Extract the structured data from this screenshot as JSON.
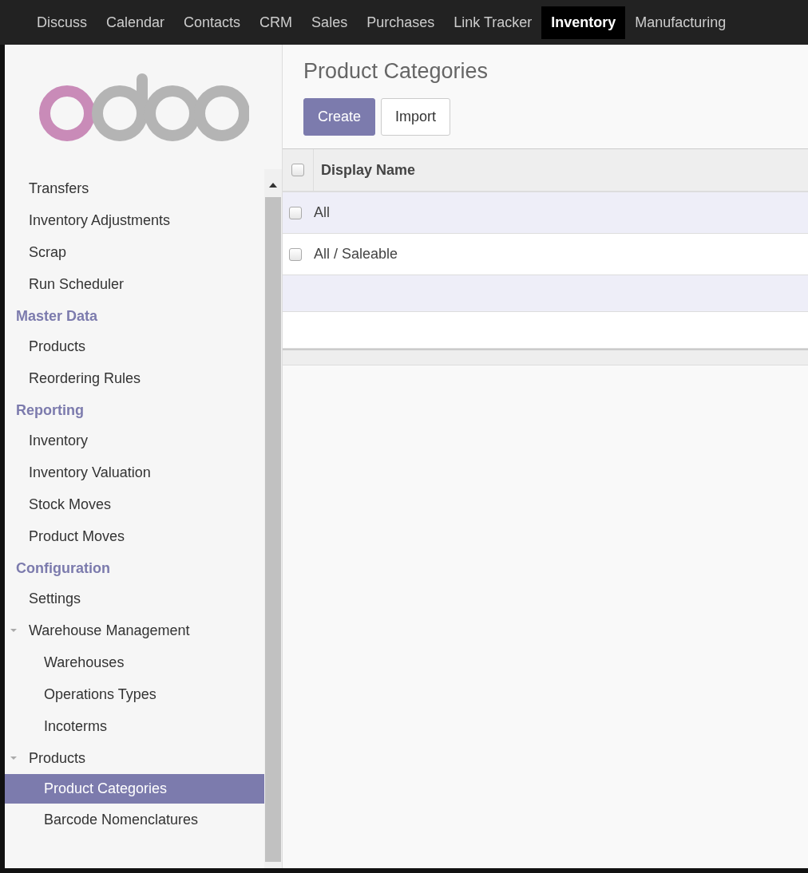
{
  "top_menu": [
    {
      "label": "Discuss",
      "selected": false
    },
    {
      "label": "Calendar",
      "selected": false
    },
    {
      "label": "Contacts",
      "selected": false
    },
    {
      "label": "CRM",
      "selected": false
    },
    {
      "label": "Sales",
      "selected": false
    },
    {
      "label": "Purchases",
      "selected": false
    },
    {
      "label": "Link Tracker",
      "selected": false
    },
    {
      "label": "Inventory",
      "selected": true
    },
    {
      "label": "Manufacturing",
      "selected": false
    }
  ],
  "sidebar": {
    "sections": [
      {
        "items": [
          {
            "label": "Transfers",
            "selected": false
          },
          {
            "label": "Inventory Adjustments",
            "selected": false
          },
          {
            "label": "Scrap",
            "selected": false
          },
          {
            "label": "Run Scheduler",
            "selected": false
          }
        ]
      },
      {
        "heading": "Master Data",
        "items": [
          {
            "label": "Products",
            "selected": false
          },
          {
            "label": "Reordering Rules",
            "selected": false
          }
        ]
      },
      {
        "heading": "Reporting",
        "items": [
          {
            "label": "Inventory",
            "selected": false
          },
          {
            "label": "Inventory Valuation",
            "selected": false
          },
          {
            "label": "Stock Moves",
            "selected": false
          },
          {
            "label": "Product Moves",
            "selected": false
          }
        ]
      },
      {
        "heading": "Configuration",
        "items": [
          {
            "label": "Settings",
            "selected": false
          },
          {
            "label": "Warehouse Management",
            "selected": false,
            "expanded": true,
            "children": [
              {
                "label": "Warehouses",
                "selected": false
              },
              {
                "label": "Operations Types",
                "selected": false
              },
              {
                "label": "Incoterms",
                "selected": false
              }
            ]
          },
          {
            "label": "Products",
            "selected": false,
            "expanded": true,
            "children": [
              {
                "label": "Product Categories",
                "selected": true
              },
              {
                "label": "Barcode Nomenclatures",
                "selected": false
              }
            ]
          }
        ]
      }
    ]
  },
  "main": {
    "title": "Product Categories",
    "buttons": [
      {
        "label": "Create",
        "kind": "primary"
      },
      {
        "label": "Import",
        "kind": "secondary"
      }
    ],
    "table": {
      "columns": [
        {
          "label": "Display Name",
          "checked": false
        }
      ],
      "rows": [
        {
          "cells": [
            "All"
          ],
          "checked": false
        },
        {
          "cells": [
            "All / Saleable"
          ],
          "checked": false
        }
      ]
    }
  }
}
